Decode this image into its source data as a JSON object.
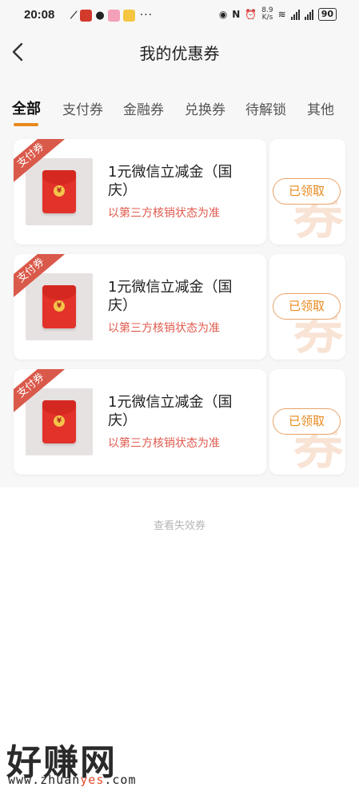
{
  "status_bar": {
    "time": "20:08",
    "more": "···",
    "speed": "8.9\nK/s",
    "battery": "90"
  },
  "header": {
    "title": "我的优惠券"
  },
  "tabs": [
    {
      "label": "全部"
    },
    {
      "label": "支付券"
    },
    {
      "label": "金融券"
    },
    {
      "label": "兑换券"
    },
    {
      "label": "待解锁"
    },
    {
      "label": "其他"
    }
  ],
  "coupons": [
    {
      "ribbon": "支付券",
      "title": "1元微信立减金（国庆）",
      "desc": "以第三方核销状态为准",
      "button": "已领取",
      "bg_char": "券"
    },
    {
      "ribbon": "支付券",
      "title": "1元微信立减金（国庆）",
      "desc": "以第三方核销状态为准",
      "button": "已领取",
      "bg_char": "券"
    },
    {
      "ribbon": "支付券",
      "title": "1元微信立减金（国庆）",
      "desc": "以第三方核销状态为准",
      "button": "已领取",
      "bg_char": "券"
    }
  ],
  "expired_link": "查看失效券",
  "watermark": {
    "brand": "好赚网",
    "url_prefix": "www.zhuan",
    "url_highlight": "yes",
    "url_suffix": ".com"
  },
  "colors": {
    "accent": "#e8891e",
    "ribbon": "#d9594a",
    "desc": "#e05a4e",
    "envelope": "#e3322a"
  }
}
